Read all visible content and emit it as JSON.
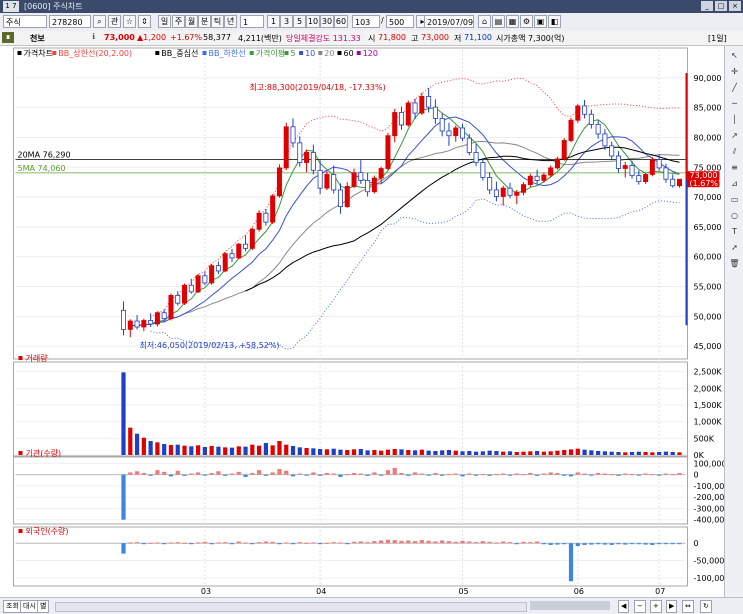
{
  "window": {
    "title": "[0600] 주식차트",
    "icon_label": "1 7"
  },
  "toolbar": {
    "market": "주식",
    "code": "278280",
    "period_buttons": [
      "주",
      "월",
      "분",
      "틱",
      "년"
    ],
    "interval_value": "1",
    "minute_buttons": [
      "1",
      "3",
      "5",
      "10",
      "30",
      "60"
    ],
    "count_value": "103",
    "count_total": "500",
    "date": "2019/07/09"
  },
  "infobar": {
    "name": "천보",
    "price": "73,000",
    "change": "▲1,200",
    "change_pct": "+1.67%",
    "volume": "58,377",
    "amount": "4,211(백만)",
    "strength": "당일체결강도 131.33",
    "open_label": "시",
    "open": "71,800",
    "high_label": "고",
    "high": "73,000",
    "low_label": "저",
    "low": "71,100",
    "marketcap": "시가총액 7,300(억)",
    "unit": "[1일]"
  },
  "chart_data": [
    {
      "type": "candlestick",
      "legend": [
        "가격차트",
        "BB_상한선(20,2.00)",
        "BB_중심선",
        "BB_하한선",
        "가격이평",
        "5",
        "10",
        "20",
        "60",
        "120"
      ],
      "y_ticks": [
        "90,000",
        "85,000",
        "80,000",
        "75,000",
        "70,000",
        "65,000",
        "60,000",
        "55,000",
        "50,000",
        "45,000"
      ],
      "ylim": [
        43000,
        92000
      ],
      "x_ticks": [
        "03",
        "04",
        "05",
        "06",
        "07"
      ],
      "annotations": {
        "high": "최고:88,300(2019/04/18, -17.33%)",
        "low": "최저:46,050(2019/02/13, +58.52%)"
      },
      "line_labels": {
        "ma20": "20MA 76,290",
        "ma5": "5MA 74,060"
      },
      "last_price": "73,000",
      "last_change": "(1.67%)",
      "candles": [
        [
          51000,
          52500,
          46800,
          47800
        ],
        [
          47800,
          49500,
          46500,
          49200
        ],
        [
          49200,
          50200,
          47800,
          48200
        ],
        [
          48200,
          49600,
          47500,
          49300
        ],
        [
          49300,
          50500,
          48200,
          48700
        ],
        [
          48700,
          50800,
          48300,
          50600
        ],
        [
          50600,
          51200,
          49100,
          49600
        ],
        [
          49600,
          53800,
          49300,
          53500
        ],
        [
          53500,
          54200,
          51800,
          52200
        ],
        [
          52200,
          55500,
          51900,
          55200
        ],
        [
          55200,
          56300,
          53800,
          54100
        ],
        [
          54100,
          57100,
          53900,
          56800
        ],
        [
          56800,
          57500,
          55200,
          55600
        ],
        [
          55600,
          58800,
          55300,
          58500
        ],
        [
          58500,
          59200,
          57100,
          57600
        ],
        [
          57600,
          60800,
          57400,
          60500
        ],
        [
          60500,
          61300,
          59100,
          59800
        ],
        [
          59800,
          62300,
          59600,
          62100
        ],
        [
          62100,
          63600,
          60900,
          61400
        ],
        [
          61400,
          64900,
          61100,
          64600
        ],
        [
          64600,
          67800,
          64200,
          67300
        ],
        [
          67300,
          68000,
          65200,
          65800
        ],
        [
          65800,
          70500,
          65500,
          70200
        ],
        [
          70200,
          75500,
          69900,
          74900
        ],
        [
          74900,
          82500,
          74500,
          81800
        ],
        [
          81800,
          83200,
          78300,
          79100
        ],
        [
          79100,
          80200,
          75100,
          75800
        ],
        [
          75800,
          78000,
          74200,
          77500
        ],
        [
          77500,
          78800,
          73800,
          74500
        ],
        [
          74500,
          76200,
          70500,
          71500
        ],
        [
          71500,
          74400,
          71200,
          73800
        ],
        [
          73800,
          75300,
          70600,
          71200
        ],
        [
          71200,
          72300,
          67200,
          68400
        ],
        [
          68400,
          72500,
          68200,
          71800
        ],
        [
          71800,
          74800,
          71500,
          74100
        ],
        [
          74100,
          76200,
          72200,
          72800
        ],
        [
          72800,
          74100,
          70100,
          70900
        ],
        [
          70900,
          73600,
          70600,
          73200
        ],
        [
          73200,
          75100,
          72300,
          74800
        ],
        [
          74800,
          80800,
          74500,
          80300
        ],
        [
          80300,
          84800,
          79200,
          84200
        ],
        [
          84200,
          85200,
          81300,
          82100
        ],
        [
          82100,
          86200,
          81800,
          85800
        ],
        [
          85800,
          86500,
          83100,
          84100
        ],
        [
          84100,
          87500,
          83800,
          86900
        ],
        [
          86900,
          88300,
          84200,
          85100
        ],
        [
          85100,
          86400,
          82300,
          83200
        ],
        [
          83200,
          84100,
          80200,
          81100
        ],
        [
          81100,
          82500,
          78600,
          80300
        ],
        [
          80300,
          82000,
          79300,
          81600
        ],
        [
          81600,
          82300,
          79400,
          79900
        ],
        [
          79900,
          80600,
          77000,
          77500
        ],
        [
          77500,
          78900,
          75200,
          75800
        ],
        [
          75800,
          76500,
          72800,
          73300
        ],
        [
          73300,
          74200,
          70500,
          71200
        ],
        [
          71200,
          72600,
          69300,
          70100
        ],
        [
          70100,
          71900,
          68600,
          71500
        ],
        [
          71500,
          72400,
          69800,
          70300
        ],
        [
          70300,
          71200,
          68800,
          70800
        ],
        [
          70800,
          72500,
          70300,
          72100
        ],
        [
          72100,
          73900,
          71700,
          73500
        ],
        [
          73500,
          74600,
          72200,
          72800
        ],
        [
          72800,
          74100,
          72400,
          73700
        ],
        [
          73700,
          75300,
          73300,
          74900
        ],
        [
          74900,
          76800,
          74600,
          76400
        ],
        [
          76400,
          79900,
          76100,
          79500
        ],
        [
          79500,
          83300,
          79200,
          82900
        ],
        [
          82900,
          85600,
          82500,
          85300
        ],
        [
          85300,
          86300,
          83200,
          83900
        ],
        [
          83900,
          84700,
          81500,
          82200
        ],
        [
          82200,
          82900,
          79800,
          80600
        ],
        [
          80600,
          81400,
          77900,
          78600
        ],
        [
          78600,
          79300,
          76200,
          76900
        ],
        [
          76900,
          77700,
          74100,
          74800
        ],
        [
          74800,
          75900,
          73300,
          75300
        ],
        [
          75300,
          76100,
          73100,
          73600
        ],
        [
          73600,
          74500,
          72100,
          72600
        ],
        [
          72600,
          74100,
          72200,
          73800
        ],
        [
          73800,
          76700,
          73500,
          76300
        ],
        [
          76300,
          77200,
          74400,
          74900
        ],
        [
          74900,
          75600,
          72400,
          73000
        ],
        [
          73000,
          73800,
          71600,
          71900
        ],
        [
          71900,
          73000,
          71600,
          73000
        ]
      ]
    },
    {
      "type": "bar",
      "title": "거래량",
      "y_ticks": [
        "2,500K",
        "2,000K",
        "1,500K",
        "1,000K",
        "500K",
        "0K"
      ],
      "ylim": [
        0,
        2700000
      ],
      "values": [
        2480000,
        820000,
        640000,
        520000,
        420000,
        380000,
        330000,
        300000,
        310000,
        280000,
        260000,
        290000,
        240000,
        270000,
        250000,
        230000,
        220000,
        260000,
        250000,
        310000,
        280000,
        360000,
        290000,
        420000,
        310000,
        270000,
        230000,
        210000,
        200000,
        180000,
        170000,
        190000,
        160000,
        150000,
        170000,
        180000,
        140000,
        150000,
        130000,
        160000,
        180000,
        170000,
        150000,
        140000,
        160000,
        130000,
        120000,
        140000,
        150000,
        130000,
        110000,
        120000,
        100000,
        110000,
        130000,
        120000,
        100000,
        110000,
        90000,
        100000,
        110000,
        120000,
        100000,
        110000,
        130000,
        150000,
        170000,
        190000,
        160000,
        140000,
        120000,
        110000,
        100000,
        90000,
        80000,
        90000,
        100000,
        90000,
        80000,
        90000,
        100000,
        90000,
        80000
      ]
    },
    {
      "type": "bar",
      "title": "기관(수량)",
      "y_ticks": [
        "100,000",
        "0",
        "-100,000",
        "-200,000",
        "-300,000",
        "-400,000"
      ],
      "ylim": [
        -420000,
        130000
      ],
      "values": [
        -400000,
        20000,
        30000,
        15000,
        -10000,
        40000,
        25000,
        -15000,
        35000,
        -10000,
        10000,
        20000,
        -5000,
        15000,
        30000,
        -10000,
        10000,
        25000,
        -20000,
        15000,
        40000,
        -10000,
        20000,
        50000,
        35000,
        -15000,
        10000,
        -5000,
        20000,
        -10000,
        15000,
        10000,
        -20000,
        5000,
        15000,
        10000,
        -10000,
        20000,
        -5000,
        40000,
        60000,
        15000,
        -10000,
        20000,
        10000,
        -5000,
        15000,
        -10000,
        5000,
        10000,
        -15000,
        10000,
        -5000,
        5000,
        -10000,
        5000,
        10000,
        -5000,
        10000,
        5000,
        15000,
        -10000,
        10000,
        20000,
        15000,
        -10000,
        -15000,
        20000,
        10000,
        -5000,
        15000,
        10000,
        5000,
        -10000,
        10000,
        5000,
        -5000,
        10000,
        5000,
        -5000,
        10000,
        5000,
        15000
      ]
    },
    {
      "type": "bar",
      "title": "외국인(수량)",
      "y_ticks": [
        "0",
        "-50,000",
        "-100,000"
      ],
      "ylim": [
        -115000,
        15000
      ],
      "values": [
        -30000,
        2000,
        3000,
        -2000,
        1000,
        2000,
        -1000,
        2000,
        3000,
        1000,
        -2000,
        2000,
        4000,
        -3000,
        2000,
        3000,
        -1000,
        5000,
        2000,
        -2000,
        3000,
        5000,
        4000,
        -3000,
        2000,
        -2000,
        3000,
        1000,
        2000,
        -2000,
        1000,
        3000,
        2000,
        -1000,
        4000,
        5000,
        3000,
        6000,
        8000,
        10000,
        9000,
        7000,
        8000,
        6000,
        9000,
        7000,
        5000,
        8000,
        6000,
        4000,
        7000,
        5000,
        3000,
        6000,
        4000,
        2000,
        5000,
        3000,
        -2000,
        4000,
        3000,
        5000,
        -3000,
        -5000,
        -4000,
        -3000,
        -110000,
        -8000,
        -5000,
        -4000,
        -3000,
        -4000,
        -5000,
        -3000,
        -4000,
        -2000,
        -3000,
        -4000,
        -5000,
        -3000,
        -2000,
        -1000,
        -2000
      ]
    }
  ],
  "right_panel_icons": [
    "pointer-icon",
    "cross-icon",
    "line-icon",
    "hline-icon",
    "vline-icon",
    "ray-icon",
    "channel-icon",
    "fibo-icon",
    "gann-icon",
    "rect-icon",
    "circle-icon",
    "text-icon",
    "arrow-icon",
    "trash-icon"
  ],
  "bottom": {
    "tabs": [
      "조회",
      "대시",
      "별"
    ]
  }
}
